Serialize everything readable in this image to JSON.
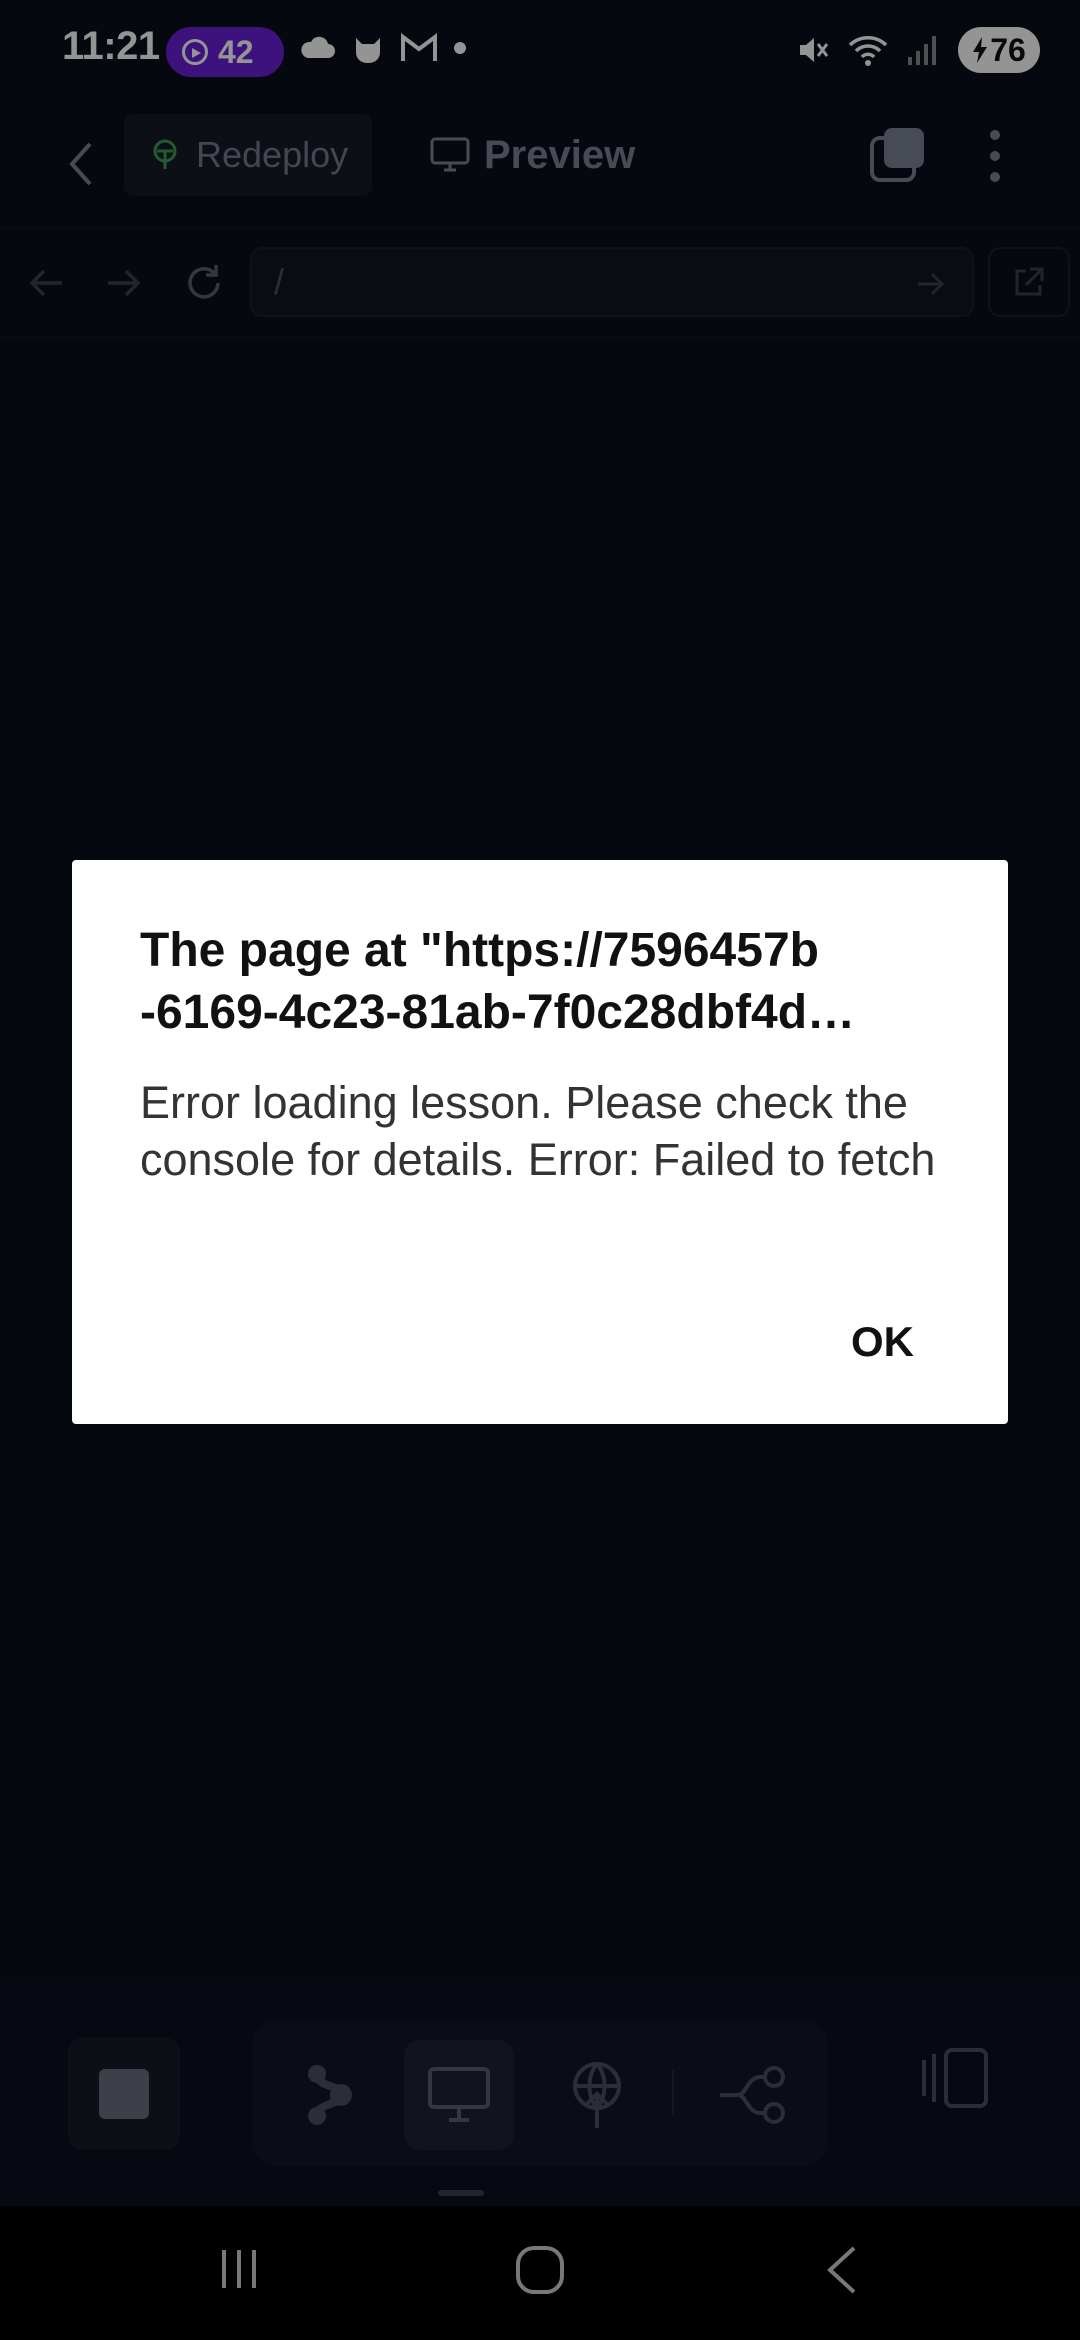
{
  "status_bar": {
    "time": "11:21",
    "notification_count": "42",
    "battery": "76",
    "icons": [
      "cloud-icon",
      "cat-icon",
      "gmail-icon",
      "dot-icon",
      "mute-icon",
      "wifi-icon",
      "signal-icon",
      "battery-icon"
    ]
  },
  "app_bar": {
    "redeploy_label": "Redeploy",
    "preview_label": "Preview"
  },
  "url_bar": {
    "value": "/"
  },
  "dialog": {
    "title_line1": "The page at \"https://7596457b",
    "title_line2": "-6169-4c23-81ab-7f0c28dbf4d…",
    "message": "Error loading lesson. Please check the console for details. Error: Failed to fetch",
    "ok_label": "OK"
  },
  "bottom_toolbar": {
    "tools": [
      "run-icon",
      "monitor-icon",
      "deploy-icon",
      "git-icon"
    ],
    "active_tool": "monitor-icon"
  },
  "colors": {
    "background": "#0b0e1b",
    "accent_purple": "#6a1fd6",
    "redeploy_green": "#3f9c54",
    "dialog_bg": "#ffffff"
  }
}
